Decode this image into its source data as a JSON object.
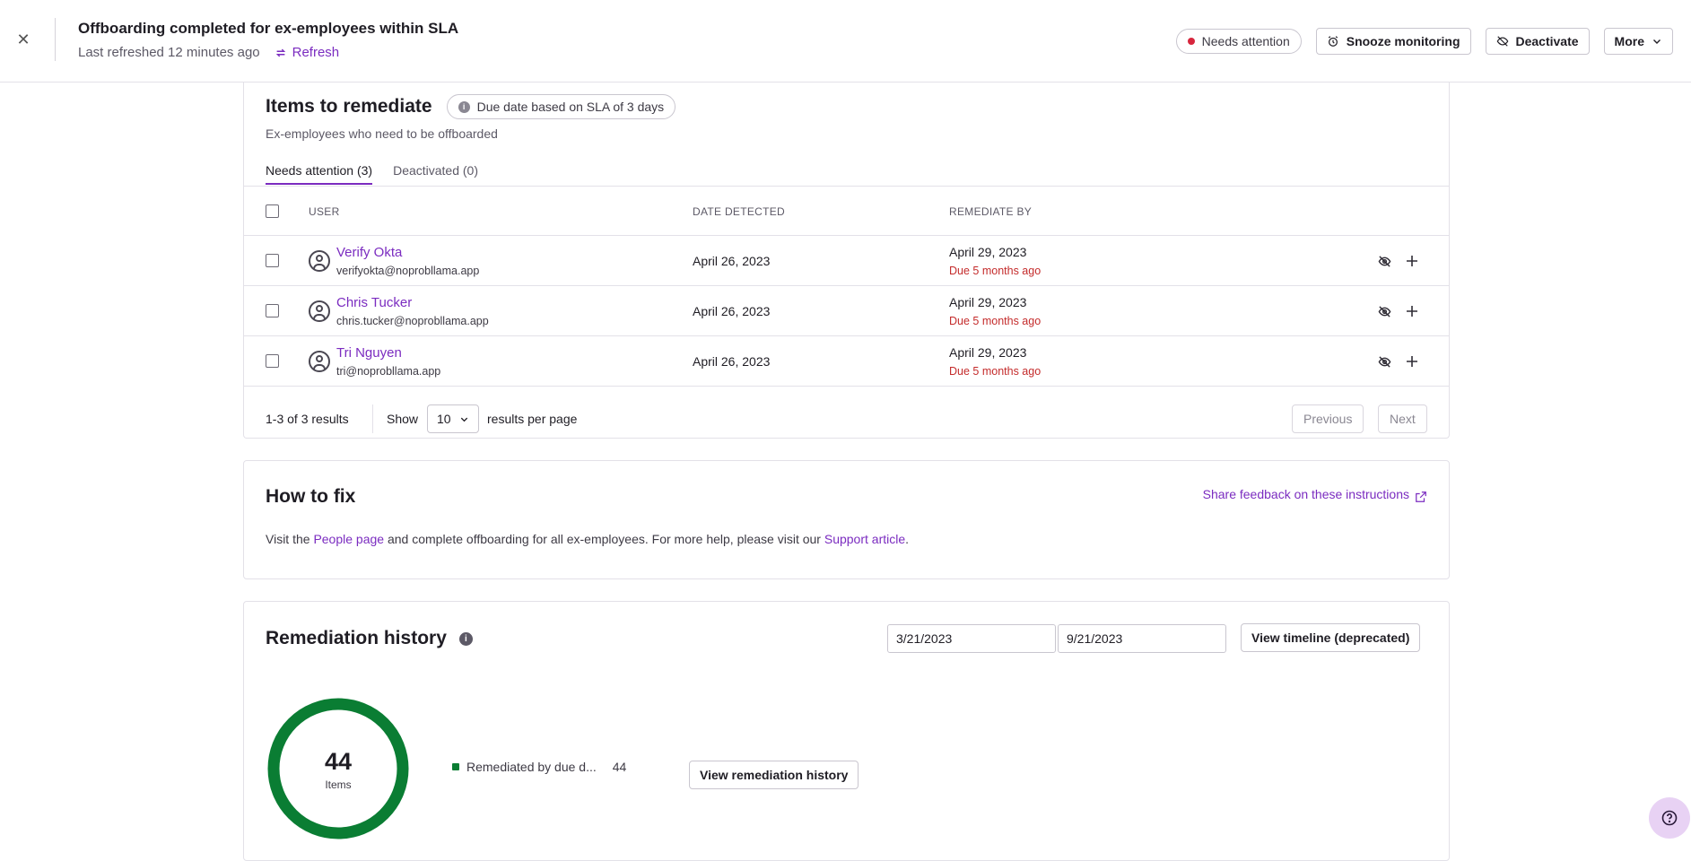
{
  "header": {
    "title": "Offboarding completed for ex-employees within SLA",
    "last_refreshed": "Last refreshed 12 minutes ago",
    "refresh_label": "Refresh",
    "status_label": "Needs attention",
    "snooze_label": "Snooze monitoring",
    "deactivate_label": "Deactivate",
    "more_label": "More"
  },
  "remediate": {
    "title": "Items to remediate",
    "sla_pill": "Due date based on SLA of 3 days",
    "subtitle": "Ex-employees who need to be offboarded",
    "tabs": [
      {
        "label": "Needs attention (3)"
      },
      {
        "label": "Deactivated (0)"
      }
    ],
    "columns": {
      "user": "USER",
      "date_detected": "DATE DETECTED",
      "remediate_by": "REMEDIATE BY"
    },
    "rows": [
      {
        "name": "Verify Okta",
        "email": "verifyokta@noprobllama.app",
        "date_detected": "April 26, 2023",
        "remediate_by": "April 29, 2023",
        "due": "Due 5 months ago"
      },
      {
        "name": "Chris Tucker",
        "email": "chris.tucker@noprobllama.app",
        "date_detected": "April 26, 2023",
        "remediate_by": "April 29, 2023",
        "due": "Due 5 months ago"
      },
      {
        "name": "Tri Nguyen",
        "email": "tri@noprobllama.app",
        "date_detected": "April 26, 2023",
        "remediate_by": "April 29, 2023",
        "due": "Due 5 months ago"
      }
    ],
    "footer": {
      "results": "1-3 of 3 results",
      "show": "Show",
      "per_page_value": "10",
      "per_page_suffix": "results per page",
      "previous": "Previous",
      "next": "Next"
    }
  },
  "howto": {
    "title": "How to fix",
    "feedback_link": "Share feedback on these instructions",
    "text_1": "Visit the ",
    "link_people": "People page",
    "text_2": " and complete offboarding for all ex-employees. For more help, please visit our ",
    "link_support": "Support article",
    "text_3": "."
  },
  "history": {
    "title": "Remediation history",
    "start_date": "3/21/2023",
    "end_date": "9/21/2023",
    "timeline_button": "View timeline (deprecated)",
    "donut_total": "44",
    "donut_unit": "Items",
    "legend_label": "Remediated by due d...",
    "legend_value": "44",
    "legend_color": "#0a7d33",
    "history_button": "View remediation history"
  },
  "colors": {
    "accent": "#7b2cc0",
    "danger": "#c42b2b",
    "success": "#0a7d33"
  }
}
